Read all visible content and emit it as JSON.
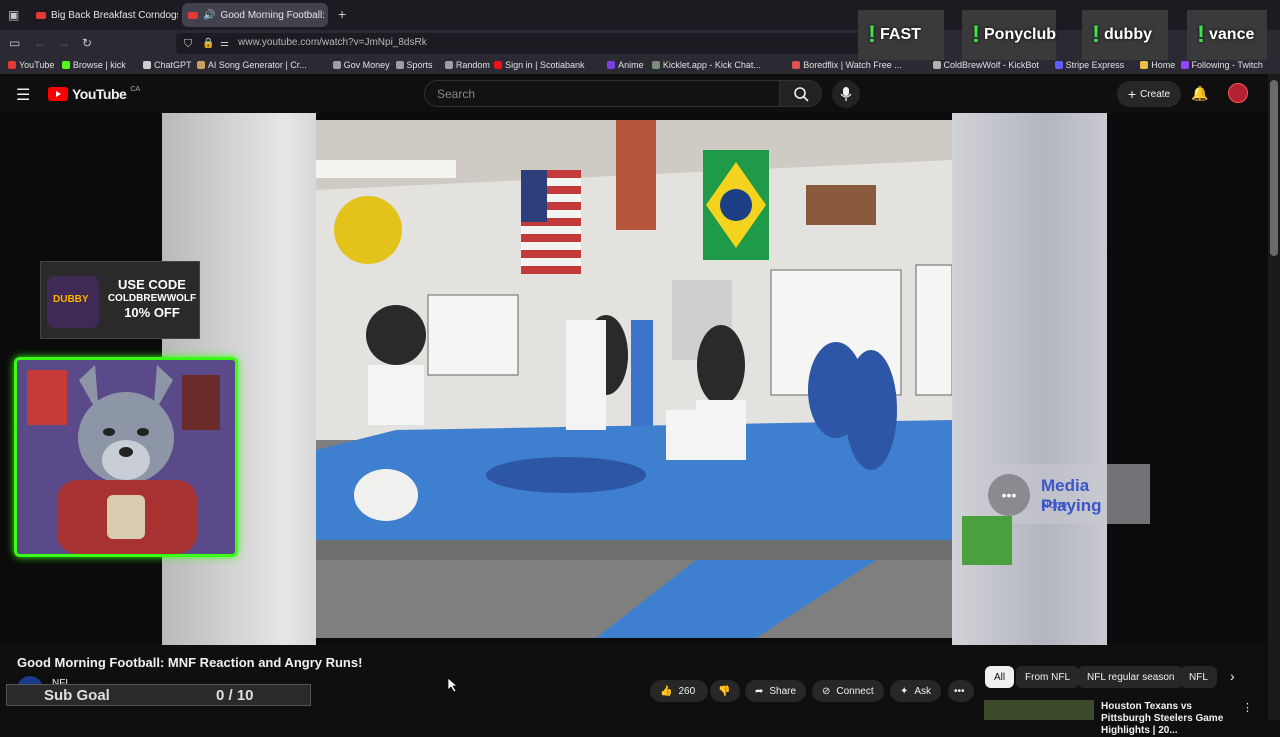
{
  "browser": {
    "tabs": [
      {
        "title": "Big Back Breakfast Corndogs - \\",
        "active": false
      },
      {
        "title": "Good Morning Football: M",
        "active": true
      }
    ],
    "url": "www.youtube.com/watch?v=JmNpi_8dsRk",
    "bookmarks": [
      {
        "label": "YouTube",
        "color": "#e53935"
      },
      {
        "label": "Browse | kick",
        "color": "#53fc18"
      },
      {
        "label": "ChatGPT",
        "color": "#cfcfcf"
      },
      {
        "label": "AI Song Generator | Cr...",
        "color": "#c8a060"
      },
      {
        "label": "Gov Money",
        "color": "#9aa0a6"
      },
      {
        "label": "Sports",
        "color": "#9aa0a6"
      },
      {
        "label": "Random",
        "color": "#9aa0a6"
      },
      {
        "label": "Sign in | Scotiabank",
        "color": "#ec111a"
      },
      {
        "label": "Anime",
        "color": "#7b3fe4"
      },
      {
        "label": "Kicklet.app - Kick Chat...",
        "color": "#7a8f7a"
      },
      {
        "label": "Boredflix | Watch Free ...",
        "color": "#e05050"
      },
      {
        "label": "ColdBrewWolf - KickBot",
        "color": "#b0b0b0"
      },
      {
        "label": "Stripe Express",
        "color": "#635bff"
      },
      {
        "label": "Home",
        "color": "#e8c04a"
      },
      {
        "label": "Following - Twitch",
        "color": "#9146ff"
      }
    ]
  },
  "overlays": {
    "commands": [
      {
        "bang": "!",
        "label": "FAST"
      },
      {
        "bang": "!",
        "label": "Ponyclub"
      },
      {
        "bang": "!",
        "label": "dubby"
      },
      {
        "bang": "!",
        "label": "vance"
      }
    ],
    "promo": {
      "line1": "USE CODE",
      "line2": "COLDBREWWOLF",
      "line3": "10% OFF",
      "brand": "DUBBY"
    },
    "media": {
      "title": "Media Playing",
      "status": "None"
    },
    "sub_goal": {
      "label": "Sub Goal",
      "value": "0 / 10"
    }
  },
  "youtube": {
    "logo": "YouTube",
    "region": "CA",
    "search_placeholder": "Search",
    "create_label": "Create",
    "video": {
      "title": "Good Morning Football: MNF Reaction and Angry Runs!",
      "channel": "NFL",
      "likes": "260",
      "share": "Share",
      "connect": "Connect",
      "ask": "Ask"
    },
    "chips": [
      "All",
      "From NFL",
      "NFL regular season",
      "NFL"
    ],
    "up_next": {
      "title": "Houston Texans vs Pittsburgh Steelers Game Highlights | 20..."
    }
  },
  "colors": {
    "youtube_red": "#ff0000",
    "overlay_green": "#3ee34b",
    "frame_green": "#39ff14"
  }
}
